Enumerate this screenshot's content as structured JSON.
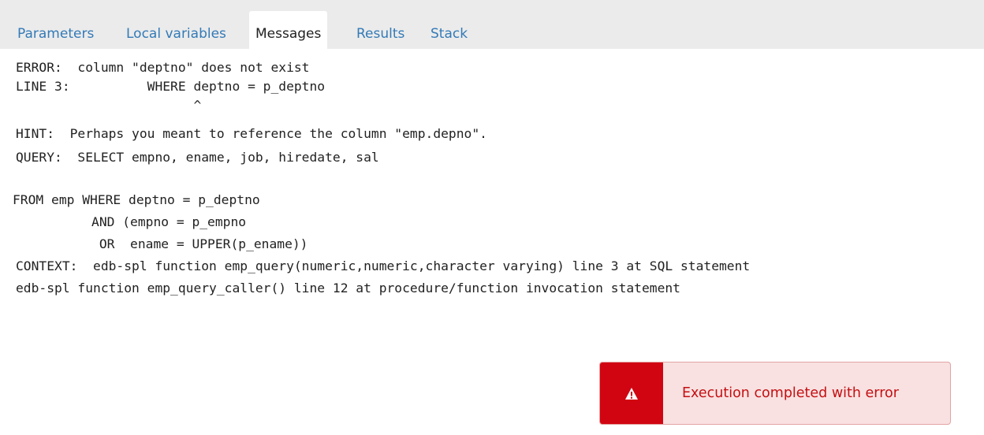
{
  "tabs": {
    "parameters": "Parameters",
    "local_variables": "Local variables",
    "messages": "Messages",
    "results": "Results",
    "stack": "Stack",
    "active": "Messages"
  },
  "messages": {
    "lines": [
      "ERROR:  column \"deptno\" does not exist",
      "LINE 3:          WHERE deptno = p_deptno",
      "                       ^",
      "HINT:  Perhaps you meant to reference the column \"emp.depno\".",
      "QUERY:  SELECT empno, ename, job, hiredate, sal",
      "",
      "FROM emp WHERE deptno = p_deptno",
      "          AND (empno = p_empno",
      "           OR  ename = UPPER(p_ename))",
      "CONTEXT:  edb-spl function emp_query(numeric,numeric,character varying) line 3 at SQL statement",
      "edb-spl function emp_query_caller() line 12 at procedure/function invocation statement"
    ]
  },
  "toast": {
    "icon": "warning-icon",
    "text": "Execution completed with error"
  },
  "colors": {
    "tab_link": "#337ab7",
    "tabbar_bg": "#ebebeb",
    "toast_icon_bg": "#d10512",
    "toast_bg": "#f9e1e1",
    "toast_text": "#c40f12"
  }
}
